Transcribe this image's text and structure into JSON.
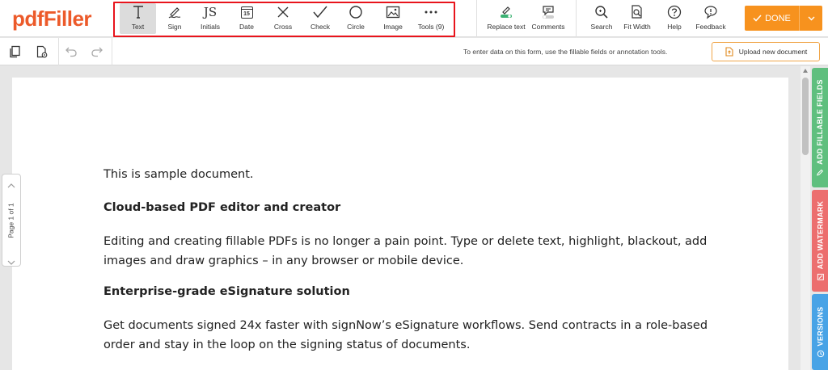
{
  "app": {
    "logo_part1": "pdf",
    "logo_part2": "Filler",
    "brand_color": "#ec5a2a"
  },
  "toolbar": {
    "tools": [
      {
        "label": "Text",
        "icon": "text-icon"
      },
      {
        "label": "Sign",
        "icon": "sign-icon"
      },
      {
        "label": "Initials",
        "icon": "initials-icon"
      },
      {
        "label": "Date",
        "icon": "date-icon"
      },
      {
        "label": "Cross",
        "icon": "cross-icon"
      },
      {
        "label": "Check",
        "icon": "check-icon"
      },
      {
        "label": "Circle",
        "icon": "circle-icon"
      },
      {
        "label": "Image",
        "icon": "image-icon"
      },
      {
        "label": "Tools (9)",
        "icon": "more-icon"
      }
    ],
    "initials_glyph": "JS",
    "date_glyph": "15",
    "replace_text": "Replace text",
    "comments": "Comments",
    "search": "Search",
    "fit_width": "Fit Width",
    "help": "Help",
    "feedback": "Feedback",
    "done": "DONE",
    "done_color": "#f7921e"
  },
  "subbar": {
    "hint": "To enter data on this form, use the fillable fields or annotation tools.",
    "upload": "Upload new document"
  },
  "document": {
    "line1": "This is sample document.",
    "heading1": "Cloud-based PDF editor and creator",
    "para1_l1": "Editing and creating fillable PDFs is no longer a pain point. Type or delete text, highlight, blackout, add",
    "para1_l2": "images and draw graphics – in any browser or mobile device.",
    "heading2": "Enterprise-grade eSignature solution",
    "para2_l1": "Get documents signed 24x faster with signNow’s eSignature workflows. Send contracts in a role-based",
    "para2_l2": "order and stay in the loop on the signing status of documents."
  },
  "pager": {
    "label": "Page 1 of 1"
  },
  "side_tabs": {
    "fillable": "ADD FILLABLE FIELDS",
    "watermark": "ADD WATERMARK",
    "versions": "VERSIONS"
  }
}
